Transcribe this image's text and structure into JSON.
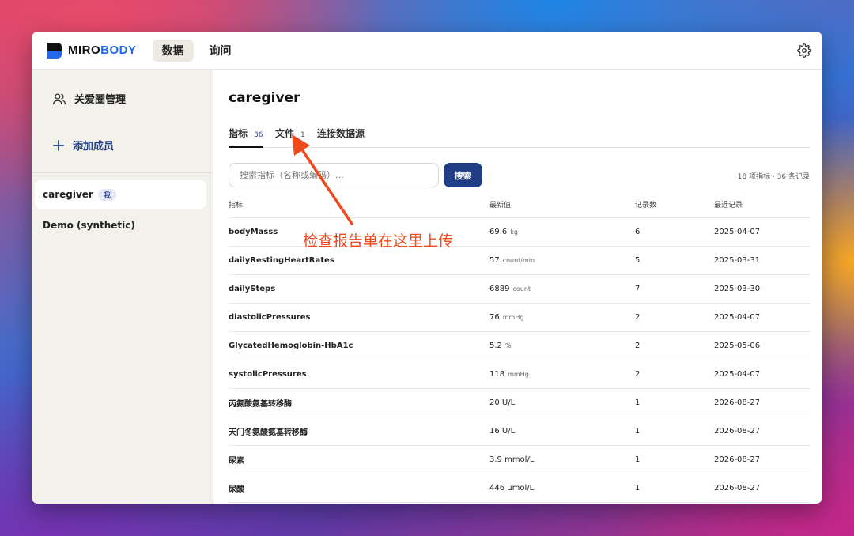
{
  "app": {
    "logo_part1": "MIRO",
    "logo_part2": "BODY",
    "nav_tabs": [
      {
        "label": "数据",
        "active": true
      },
      {
        "label": "询问",
        "active": false
      }
    ],
    "settings_icon": "gear-icon"
  },
  "sidebar": {
    "care_circle_label": "关爱圈管理",
    "add_member_label": "添加成员",
    "members": [
      {
        "name": "caregiver",
        "badge": "我",
        "active": true
      },
      {
        "name": "Demo (synthetic)",
        "badge": "",
        "active": false
      }
    ]
  },
  "main": {
    "title": "caregiver",
    "tabs": [
      {
        "label": "指标",
        "count": "36",
        "active": true
      },
      {
        "label": "文件",
        "count": "1",
        "active": false
      },
      {
        "label": "连接数据源",
        "count": "",
        "active": false
      }
    ],
    "search": {
      "placeholder": "搜索指标（名称或编码）…",
      "button_label": "搜索"
    },
    "summary": "18 项指标 · 36 条记录",
    "table": {
      "headers": [
        "指标",
        "最新值",
        "记录数",
        "最近记录"
      ],
      "rows": [
        {
          "name": "bodyMasss",
          "value": "69.6",
          "unit": "kg",
          "count": "6",
          "date": "2025-04-07"
        },
        {
          "name": "dailyRestingHeartRates",
          "value": "57",
          "unit": "count/min",
          "count": "5",
          "date": "2025-03-31"
        },
        {
          "name": "dailySteps",
          "value": "6889",
          "unit": "count",
          "count": "7",
          "date": "2025-03-30"
        },
        {
          "name": "diastolicPressures",
          "value": "76",
          "unit": "mmHg",
          "count": "2",
          "date": "2025-04-07"
        },
        {
          "name": "GlycatedHemoglobin-HbA1c",
          "value": "5.2",
          "unit": "%",
          "count": "2",
          "date": "2025-05-06"
        },
        {
          "name": "systolicPressures",
          "value": "118",
          "unit": "mmHg",
          "count": "2",
          "date": "2025-04-07"
        },
        {
          "name": "丙氨酸氨基转移酶",
          "value": "20 U/L",
          "unit": "",
          "count": "1",
          "date": "2026-08-27"
        },
        {
          "name": "天门冬氨酸氨基转移酶",
          "value": "16 U/L",
          "unit": "",
          "count": "1",
          "date": "2026-08-27"
        },
        {
          "name": "尿素",
          "value": "3.9 mmol/L",
          "unit": "",
          "count": "1",
          "date": "2026-08-27"
        },
        {
          "name": "尿酸",
          "value": "446 µmol/L",
          "unit": "",
          "count": "1",
          "date": "2026-08-27"
        }
      ]
    }
  },
  "annotation": {
    "text": "检查报告单在这里上传",
    "color": "#ee4a1c"
  }
}
